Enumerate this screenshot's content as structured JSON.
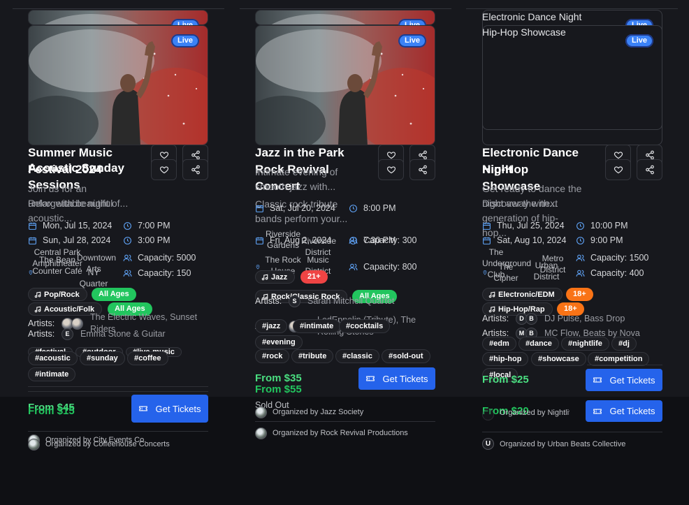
{
  "badge_live": "Live",
  "artists_label": "Artists:",
  "get_tickets": "Get Tickets",
  "colors": {
    "accent": "#2563eb",
    "live": "#3b82f6",
    "all_ages": "#22c55e",
    "age_21": "#ef4444",
    "age_18": "#f97316",
    "price": "#4ade80"
  },
  "icons": [
    "heart-icon",
    "share-icon",
    "calendar-icon",
    "clock-icon",
    "pin-icon",
    "users-icon",
    "music-icon",
    "ticket-icon"
  ],
  "col1": {
    "a": {
      "title": "Summer Music Festival 2024",
      "desc": "Join us for an unforgettable night of...",
      "date": "Mon, Jul 15, 2024",
      "time": "7:00 PM",
      "loc1": "Central Park Amphitheater",
      "loc2": "Downtown Arts",
      "capacity": "Capacity: 5000",
      "genre": "Pop/Rock",
      "age": "All Ages",
      "artists": "The Electric Waves, Sunset Riders",
      "tags": [
        "#festival",
        "#outdoor",
        "#live-music"
      ],
      "price": "From $45",
      "organizer": "Organized by City Events Co."
    },
    "b": {
      "title": "Acoustic Sunday Sessions",
      "desc": "Relax with beautiful acoustic...",
      "date": "Sun, Jul 28, 2024",
      "time": "3:00 PM",
      "loc1": "The Bean Counter Café",
      "loc2": "NY Quarter",
      "capacity": "Capacity: 150",
      "genre": "Acoustic/Folk",
      "age": "All Ages",
      "artist_initial": "E",
      "artists": "Emma Stone & Guitar",
      "tags": [
        "#acoustic",
        "#sunday",
        "#coffee",
        "#intimate"
      ],
      "price": "From $15",
      "organizer": "Organized by Coffeehouse Concerts"
    }
  },
  "col2": {
    "a": {
      "title": "Jazz in the Park",
      "desc": "Intimate evening of smooth jazz with...",
      "date": "Sat, Jul 20, 2024",
      "time": "8:00 PM",
      "loc1": "Riverside Gardens",
      "loc2": "Riverside District",
      "capacity": "Capacity: 300",
      "genre": "Jazz",
      "age": "21+",
      "artist_initial": "S",
      "artists": "Sarah Mitchell Quartet",
      "tags": [
        "#jazz",
        "#intimate",
        "#cocktails",
        "#evening"
      ],
      "price": "From $35",
      "organizer": "Organized by Jazz Society"
    },
    "b": {
      "title": "Rock Revival Concert",
      "desc": "Classic rock tribute bands perform your...",
      "date": "Fri, Aug 2, 2024",
      "time": "7:30 PM",
      "loc1": "The Rock House",
      "loc2": "Music District",
      "capacity": "Capacity: 800",
      "genre": "Rock/Classic Rock",
      "age": "All Ages",
      "artists": "LedEppelin (Tribute), The Rolling Stones",
      "tags": [
        "#rock",
        "#tribute",
        "#classic",
        "#sold-out"
      ],
      "price": "From $55",
      "status": "Sold Out",
      "organizer": "Organized by Rock Revival Productions"
    }
  },
  "col3": {
    "a": {
      "img_alt": "Electronic Dance Night",
      "title": "Electronic Dance Night",
      "desc": "Get ready to dance the night away with...",
      "date": "Thu, Jul 25, 2024",
      "time": "10:00 PM",
      "loc1": "The Underground Club",
      "loc2": "Metro District",
      "capacity": "Capacity: 1500",
      "genre": "Electronic/EDM",
      "age": "18+",
      "artist_initials": [
        "D",
        "B"
      ],
      "artists": "DJ Pulse, Bass Drop",
      "tags": [
        "#edm",
        "#dance",
        "#nightlife",
        "#dj"
      ],
      "price": "From $25",
      "organizer": "Organized by Nightlife Pro"
    },
    "b": {
      "img_alt": "Hip-Hop Showcase",
      "title": "Hip-Hop Showcase",
      "desc": "Discover the next generation of hip-hop...",
      "date": "Sat, Aug 10, 2024",
      "time": "9:00 PM",
      "loc1": "The Cipher",
      "loc2": "Urban District",
      "capacity": "Capacity: 400",
      "genre": "Hip-Hop/Rap",
      "age": "18+",
      "artist_initials": [
        "M",
        "B"
      ],
      "artists": "MC Flow, Beats by Nova",
      "tags": [
        "#hip-hop",
        "#showcase",
        "#competition",
        "#local"
      ],
      "price": "From $20",
      "org_initial": "U",
      "organizer": "Organized by Urban Beats Collective"
    }
  }
}
